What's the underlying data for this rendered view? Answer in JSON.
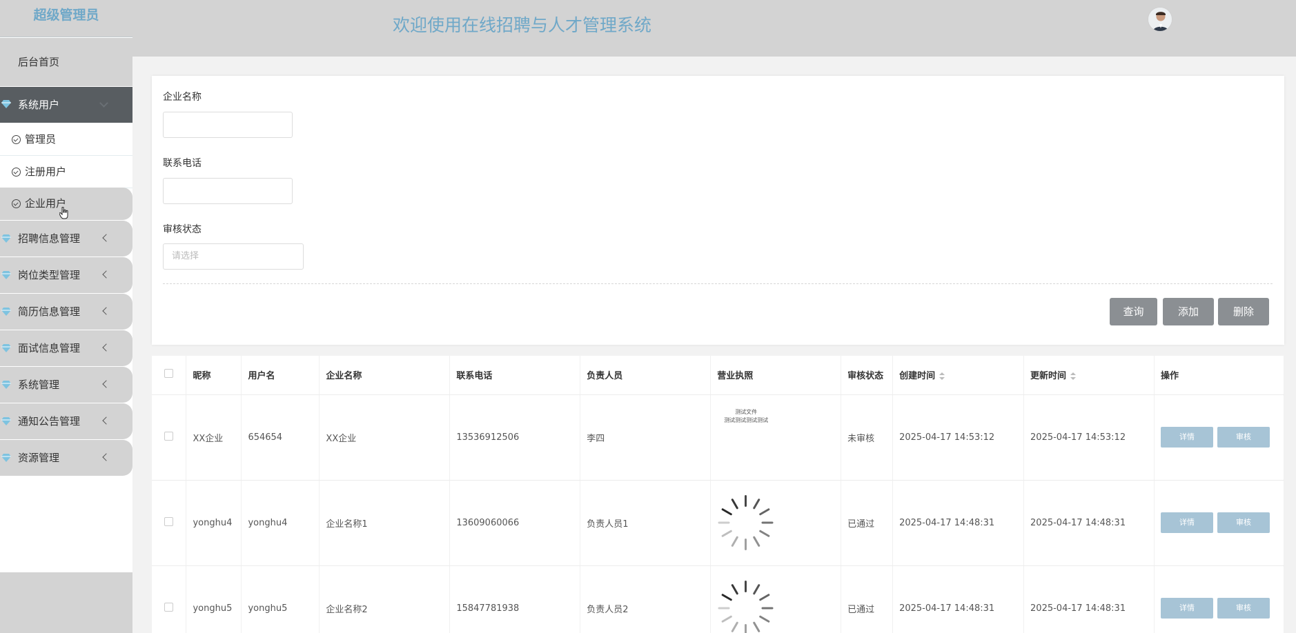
{
  "sidebar": {
    "brand": "超级管理员",
    "home": "后台首页",
    "group_open": "系统用户",
    "sub_items": [
      "管理员",
      "注册用户",
      "企业用户"
    ],
    "items": [
      "招聘信息管理",
      "岗位类型管理",
      "简历信息管理",
      "面试信息管理",
      "系统管理",
      "通知公告管理",
      "资源管理"
    ]
  },
  "header": {
    "title": "欢迎使用在线招聘与人才管理系统"
  },
  "search": {
    "company_label": "企业名称",
    "phone_label": "联系电话",
    "status_label": "审核状态",
    "status_placeholder": "请选择"
  },
  "buttons": {
    "query": "查询",
    "add": "添加",
    "delete": "删除"
  },
  "table": {
    "headers": [
      "昵称",
      "用户名",
      "企业名称",
      "联系电话",
      "负责人员",
      "营业执照",
      "审核状态",
      "创建时间",
      "更新时间",
      "操作"
    ],
    "rows": [
      {
        "nickname": "XX企业",
        "username": "654654",
        "company": "XX企业",
        "phone": "13536912506",
        "person": "李四",
        "license_text": "测试文件\n测试测试测试测试",
        "status": "未审核",
        "created": "2025-04-17 14:53:12",
        "updated": "2025-04-17 14:53:12"
      },
      {
        "nickname": "yonghu4",
        "username": "yonghu4",
        "company": "企业名称1",
        "phone": "13609060066",
        "person": "负责人员1",
        "license_text": "",
        "status": "已通过",
        "created": "2025-04-17 14:48:31",
        "updated": "2025-04-17 14:48:31"
      },
      {
        "nickname": "yonghu5",
        "username": "yonghu5",
        "company": "企业名称2",
        "phone": "15847781938",
        "person": "负责人员2",
        "license_text": "",
        "status": "已通过",
        "created": "2025-04-17 14:48:31",
        "updated": "2025-04-17 14:48:31"
      }
    ],
    "detail_label": "详情",
    "review_label": "审核"
  },
  "colors": {
    "accent": "#6fa8c8",
    "sidebar_active": "#585d61",
    "button_gray": "#8b8f93",
    "op_button": "#a7c4d6"
  }
}
